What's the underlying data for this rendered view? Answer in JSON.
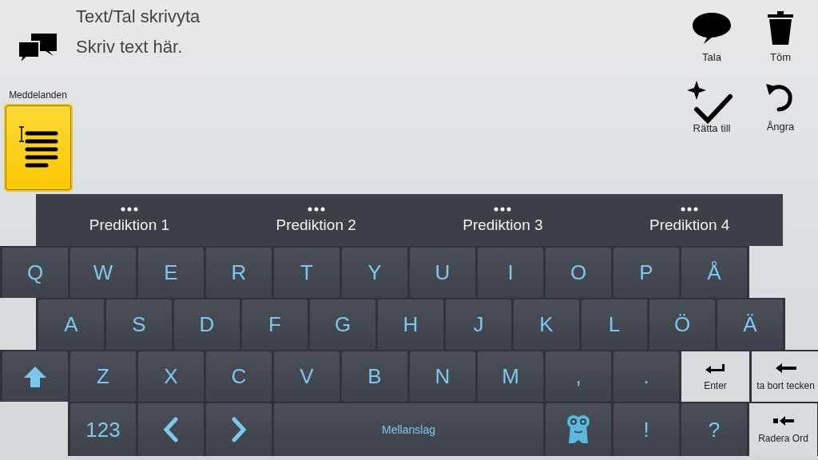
{
  "header": {
    "title": "Text/Tal skrivyta",
    "text": "Skriv text här."
  },
  "messages": {
    "label": "Meddelanden",
    "selected": true
  },
  "actions": [
    {
      "kind": "speak",
      "label": "Tala"
    },
    {
      "kind": "clear",
      "label": "Töm"
    },
    {
      "kind": "correct",
      "label": "Rätta till"
    },
    {
      "kind": "undo",
      "label": "Ångra"
    }
  ],
  "predictions": [
    {
      "label": "Prediktion 1"
    },
    {
      "label": "Prediktion 2"
    },
    {
      "label": "Prediktion 3"
    },
    {
      "label": "Prediktion 4"
    }
  ],
  "keyboard": {
    "rows": [
      {
        "keys": [
          {
            "kind": "char",
            "label": "Q"
          },
          {
            "kind": "char",
            "label": "W"
          },
          {
            "kind": "char",
            "label": "E"
          },
          {
            "kind": "char",
            "label": "R"
          },
          {
            "kind": "char",
            "label": "T"
          },
          {
            "kind": "char",
            "label": "Y"
          },
          {
            "kind": "char",
            "label": "U"
          },
          {
            "kind": "char",
            "label": "I"
          },
          {
            "kind": "char",
            "label": "O"
          },
          {
            "kind": "char",
            "label": "P"
          },
          {
            "kind": "char",
            "label": "Å"
          }
        ]
      },
      {
        "keys": [
          {
            "kind": "char",
            "label": "A"
          },
          {
            "kind": "char",
            "label": "S"
          },
          {
            "kind": "char",
            "label": "D"
          },
          {
            "kind": "char",
            "label": "F"
          },
          {
            "kind": "char",
            "label": "G"
          },
          {
            "kind": "char",
            "label": "H"
          },
          {
            "kind": "char",
            "label": "J"
          },
          {
            "kind": "char",
            "label": "K"
          },
          {
            "kind": "char",
            "label": "L"
          },
          {
            "kind": "char",
            "label": "Ö"
          },
          {
            "kind": "char",
            "label": "Ä"
          }
        ]
      },
      {
        "keys": [
          {
            "kind": "shift"
          },
          {
            "kind": "char",
            "label": "Z"
          },
          {
            "kind": "char",
            "label": "X"
          },
          {
            "kind": "char",
            "label": "C"
          },
          {
            "kind": "char",
            "label": "V"
          },
          {
            "kind": "char",
            "label": "B"
          },
          {
            "kind": "char",
            "label": "N"
          },
          {
            "kind": "char",
            "label": "M"
          },
          {
            "kind": "char",
            "label": ","
          },
          {
            "kind": "char",
            "label": "."
          },
          {
            "kind": "enter",
            "label": "Enter"
          },
          {
            "kind": "backspace",
            "label": "ta bort tecken"
          }
        ]
      },
      {
        "keys": [
          {
            "kind": "char",
            "label": "123"
          },
          {
            "kind": "left"
          },
          {
            "kind": "right"
          },
          {
            "kind": "space",
            "label": "Mellanslag"
          },
          {
            "kind": "mascot"
          },
          {
            "kind": "char",
            "label": "!"
          },
          {
            "kind": "char",
            "label": "?"
          },
          {
            "kind": "delete_word",
            "label": "Radera Ord"
          }
        ]
      }
    ]
  }
}
